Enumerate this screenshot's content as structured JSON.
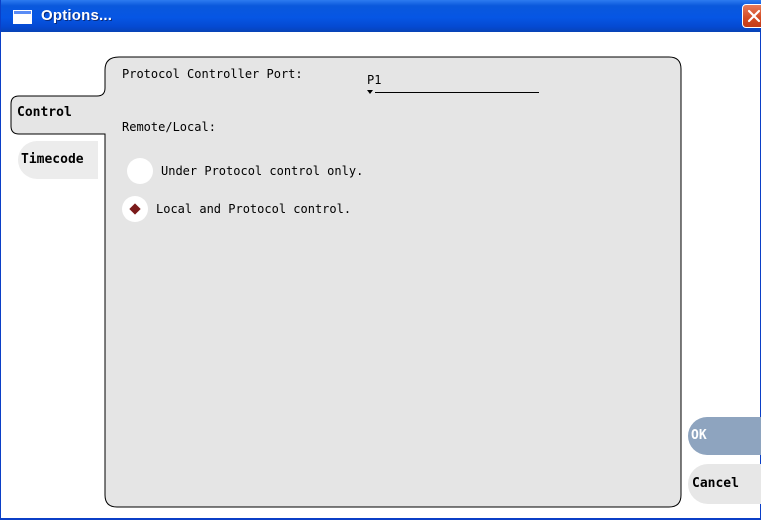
{
  "window": {
    "title": "Options...",
    "app_icon": "window-icon",
    "close_icon": "close-icon"
  },
  "tabs": [
    {
      "label": "Control",
      "selected": true
    },
    {
      "label": "Timecode",
      "selected": false
    }
  ],
  "control": {
    "port_label": "Protocol Controller Port:",
    "port_value": "P1",
    "remote_local_label": "Remote/Local:",
    "options": [
      {
        "label": "Under Protocol control only.",
        "selected": false
      },
      {
        "label": "Local and Protocol control.",
        "selected": true
      }
    ]
  },
  "buttons": {
    "ok": "OK",
    "cancel": "Cancel"
  },
  "colors": {
    "titlebar": "#0656e4",
    "panel": "#e5e5e5",
    "ok_button": "#8ea4bf",
    "selected_dot": "#7a1a1a"
  }
}
